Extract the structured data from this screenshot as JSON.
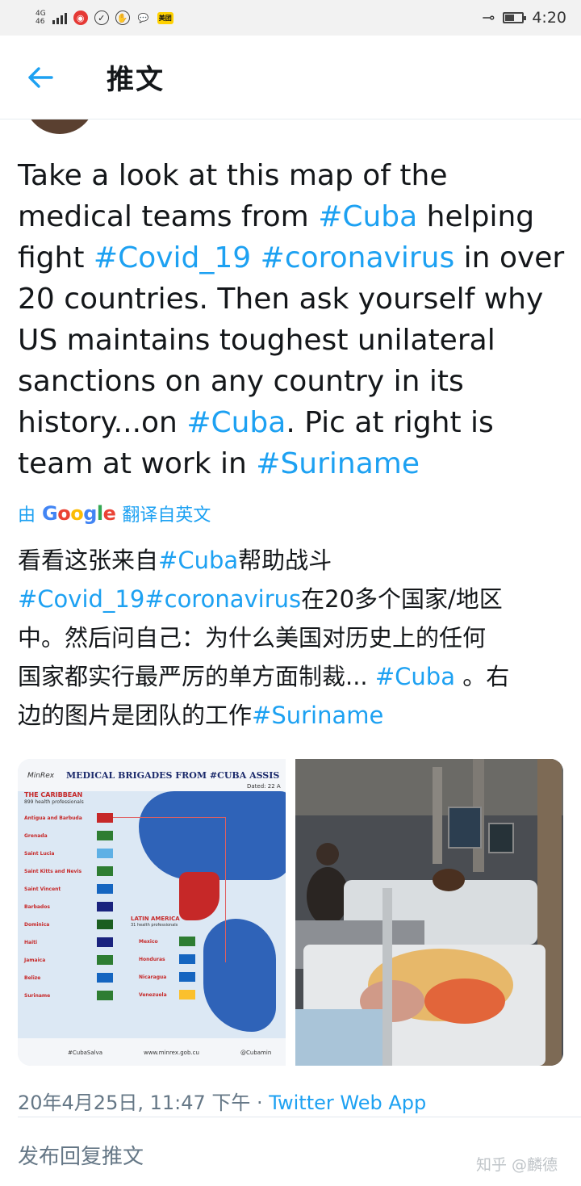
{
  "status_bar": {
    "network": "4G",
    "network_sub": "46",
    "app_badge": "美团",
    "time": "4:20",
    "icons": [
      "signal-icon",
      "notification-icon",
      "wechat-icon",
      "meituan-icon",
      "key-icon",
      "vibrate-icon",
      "battery-icon"
    ]
  },
  "header": {
    "back_icon": "arrow-left-icon",
    "title": "推文"
  },
  "tweet": {
    "lines": [
      [
        {
          "t": "Take a look at this map of the",
          "tag": false
        }
      ],
      [
        {
          "t": "medical teams from ",
          "tag": false
        },
        {
          "t": "#Cuba",
          "tag": true
        },
        {
          "t": " helping",
          "tag": false
        }
      ],
      [
        {
          "t": "fight ",
          "tag": false
        },
        {
          "t": "#Covid_19",
          "tag": true
        },
        {
          "t": " ",
          "tag": false
        },
        {
          "t": "#coronavirus",
          "tag": true
        },
        {
          "t": " in over",
          "tag": false
        }
      ],
      [
        {
          "t": "20 countries. Then ask yourself why",
          "tag": false
        }
      ],
      [
        {
          "t": "US maintains toughest unilateral",
          "tag": false
        }
      ],
      [
        {
          "t": "sanctions on any country in its",
          "tag": false
        }
      ],
      [
        {
          "t": "history...on ",
          "tag": false
        },
        {
          "t": "#Cuba",
          "tag": true
        },
        {
          "t": ".  Pic at right is",
          "tag": false
        }
      ],
      [
        {
          "t": "team at work in ",
          "tag": false
        },
        {
          "t": "#Suriname",
          "tag": true
        }
      ]
    ]
  },
  "translation": {
    "prefix": "由",
    "brand": "Google",
    "suffix": "翻译自英文",
    "lines": [
      [
        {
          "t": "看看这张来自",
          "tag": false
        },
        {
          "t": "#Cuba",
          "tag": true
        },
        {
          "t": "帮助战斗",
          "tag": false
        }
      ],
      [
        {
          "t": "#Covid_19#coronavirus",
          "tag": true
        },
        {
          "t": "在20多个国家/地区",
          "tag": false
        }
      ],
      [
        {
          "t": "中。然后问自己：为什么美国对历史上的任何",
          "tag": false
        }
      ],
      [
        {
          "t": "国家都实行最严厉的单方面制裁... ",
          "tag": false
        },
        {
          "t": "#Cuba",
          "tag": true
        },
        {
          "t": " 。右",
          "tag": false
        }
      ],
      [
        {
          "t": "边的图片是团队的工作",
          "tag": false
        },
        {
          "t": "#Suriname",
          "tag": true
        }
      ]
    ]
  },
  "media": {
    "map": {
      "logo": "MinRex",
      "title": "MEDICAL BRIGADES FROM #CUBA ASSIS",
      "dated": "Dated: 22 A",
      "region": "THE CARIBBEAN",
      "region_sub": "899 health professionals",
      "caribbean": [
        {
          "name": "Antigua and Barbuda",
          "flag": "#c62828"
        },
        {
          "name": "Grenada",
          "flag": "#2e7d32"
        },
        {
          "name": "Saint Lucia",
          "flag": "#5eb0e5"
        },
        {
          "name": "Saint Kitts and Nevis",
          "flag": "#2e7d32"
        },
        {
          "name": "Saint Vincent",
          "flag": "#1565c0"
        },
        {
          "name": "Barbados",
          "flag": "#1a237e"
        },
        {
          "name": "Dominica",
          "flag": "#1b5e20"
        },
        {
          "name": "Haiti",
          "flag": "#1a237e"
        },
        {
          "name": "Jamaica",
          "flag": "#2e7d32"
        },
        {
          "name": "Belize",
          "flag": "#1565c0"
        },
        {
          "name": "Suriname",
          "flag": "#2e7d32"
        }
      ],
      "latam_region": "LATIN AMERICA",
      "latam_sub": "31 health professionals",
      "latam": [
        {
          "name": "Mexico",
          "flag": "#2e7d32"
        },
        {
          "name": "Honduras",
          "flag": "#1565c0"
        },
        {
          "name": "Nicaragua",
          "flag": "#1565c0"
        },
        {
          "name": "Venezuela",
          "flag": "#fbc02d"
        }
      ],
      "footer_left": "#CubaSalva",
      "footer_mid": "www.minrex.gob.cu",
      "footer_right": "@Cubamin"
    },
    "photo": {}
  },
  "meta": {
    "date": "20年4月25日, 11:47 下午",
    "separator": " · ",
    "source": "Twitter Web App"
  },
  "reply": {
    "placeholder": "发布回复推文"
  },
  "watermark": "知乎 @麟德",
  "colors": {
    "link": "#1da1f2",
    "text": "#14171a",
    "secondary": "#657786"
  }
}
